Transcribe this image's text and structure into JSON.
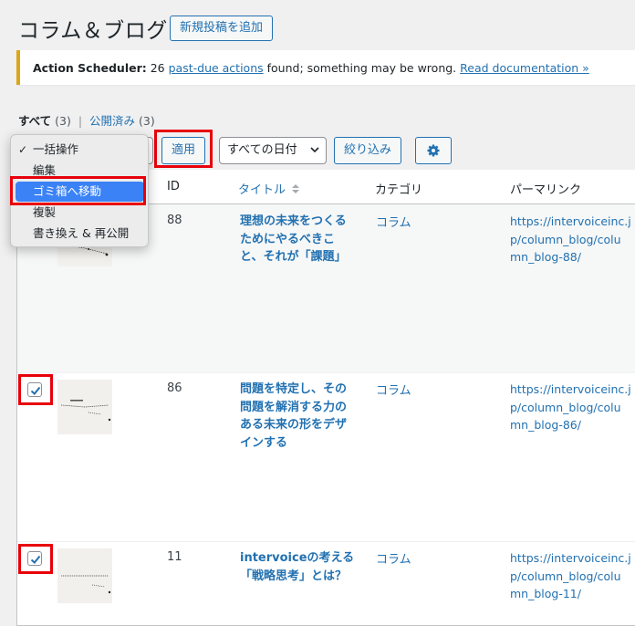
{
  "header": {
    "title": "コラム＆ブログ",
    "add_new_label": "新規投稿を追加"
  },
  "notice": {
    "prefix": "Action Scheduler:",
    "count_text": " 26 ",
    "link_label": "past-due actions",
    "middle_text": " found; something may be wrong. ",
    "doc_link_label": "Read documentation »"
  },
  "views": {
    "all_label": "すべて",
    "all_count": "(3)",
    "separator": "|",
    "published_label": "公開済み",
    "published_count": "(3)"
  },
  "toolbar": {
    "apply_label": "適用",
    "date_filter_value": "すべての日付",
    "filter_label": "絞り込み",
    "settings_icon": "gear-icon"
  },
  "bulk_menu": {
    "items": [
      {
        "label": "一括操作",
        "checked": true
      },
      {
        "label": "編集"
      },
      {
        "label": "ゴミ箱へ移動",
        "highlighted": true
      },
      {
        "label": "複製"
      },
      {
        "label": "書き換え & 再公開"
      }
    ]
  },
  "table": {
    "columns": {
      "id": "ID",
      "title": "タイトル",
      "category": "カテゴリ",
      "permalink": "パーマリンク"
    },
    "rows": [
      {
        "id": "88",
        "title_lines": [
          "理想の未来をつくる",
          "ためにやるべきこ",
          "と、それが「課題」"
        ],
        "category": "コラム",
        "permalink_lines": [
          "https://intervoiceinc.j",
          "p/column_blog/colu",
          "mn_blog-88/"
        ],
        "checked": true
      },
      {
        "id": "86",
        "title_lines": [
          "問題を特定し、その",
          "問題を解消する力の",
          "ある未来の形をデザ",
          "インする"
        ],
        "category": "コラム",
        "permalink_lines": [
          "https://intervoiceinc.j",
          "p/column_blog/colu",
          "mn_blog-86/"
        ],
        "checked": true
      },
      {
        "id": "11",
        "title_lines": [
          "intervoiceの考える",
          "「戦略思考」とは？"
        ],
        "category": "コラム",
        "permalink_lines": [
          "https://intervoiceinc.j",
          "p/column_blog/colu",
          "mn_blog-11/"
        ],
        "checked": true
      }
    ]
  },
  "colors": {
    "accent": "#2271b1",
    "highlight": "#e8000b",
    "menu_selected": "#3b82f6",
    "notice_border": "#dba617"
  }
}
